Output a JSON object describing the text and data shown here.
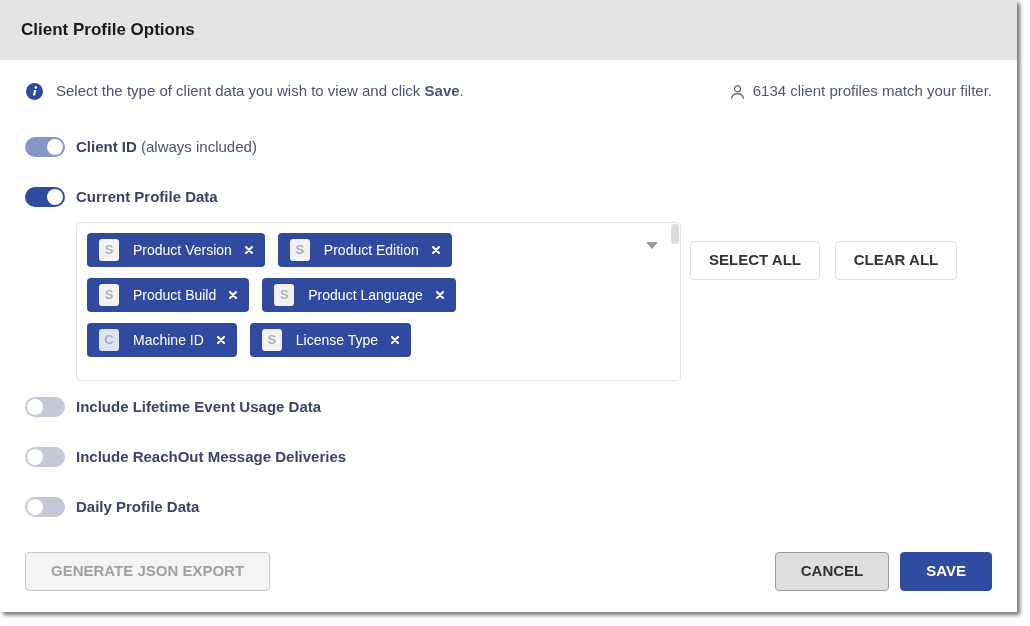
{
  "dialog": {
    "title": "Client Profile Options"
  },
  "info": {
    "text": "Select the type of client data you wish to view and click **Save**."
  },
  "match_count": {
    "text": "6134 client profiles match your filter."
  },
  "options": [
    {
      "label": "Client ID",
      "note": "(always included)",
      "on": true,
      "disabled": true
    },
    {
      "label": "Current Profile Data",
      "on": true,
      "disabled": false,
      "selector": {
        "tags": [
          {
            "label": "Product Version",
            "badge": "S",
            "color": "#f2f2f2"
          },
          {
            "label": "Product Edition",
            "badge": "S",
            "color": "#f2f2f2"
          },
          {
            "label": "Product Build",
            "badge": "S",
            "color": "#f2f2f2"
          },
          {
            "label": "Product Language",
            "badge": "S",
            "color": "#f2f2f2"
          },
          {
            "label": "Machine ID",
            "badge": "C",
            "color": "#dde5f2"
          },
          {
            "label": "License Type",
            "badge": "S",
            "color": "#f2f2f2"
          }
        ],
        "buttons": [
          {
            "label": "SELECT ALL"
          },
          {
            "label": "CLEAR ALL"
          }
        ]
      }
    },
    {
      "label": "Include Lifetime Event Usage Data",
      "on": false,
      "disabled": false
    },
    {
      "label": "Include ReachOut Message Deliveries",
      "on": false,
      "disabled": false
    },
    {
      "label": "Daily Profile Data",
      "on": false,
      "disabled": false
    }
  ],
  "footer": {
    "left_buttons": [
      {
        "label": "GENERATE JSON EXPORT",
        "kind": "outline",
        "disabled": true
      }
    ],
    "right_buttons": [
      {
        "label": "CANCEL",
        "kind": "secondary",
        "disabled": false
      },
      {
        "label": "SAVE",
        "kind": "primary",
        "disabled": false
      }
    ]
  }
}
